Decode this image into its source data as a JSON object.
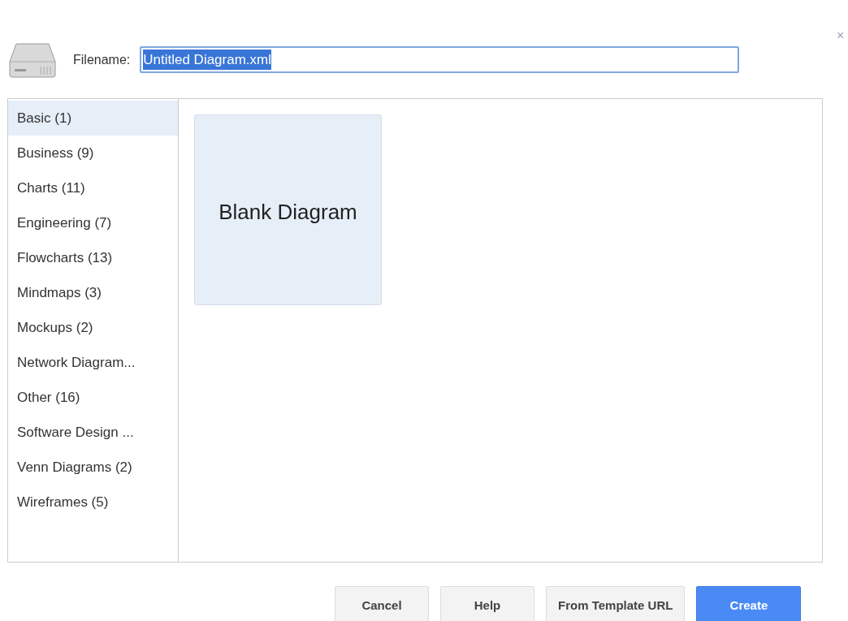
{
  "close": "×",
  "filename": {
    "label": "Filename:",
    "value": "Untitled Diagram.xml",
    "text_selected": true
  },
  "categories": [
    {
      "label": "Basic (1)",
      "selected": true
    },
    {
      "label": "Business (9)",
      "selected": false
    },
    {
      "label": "Charts (11)",
      "selected": false
    },
    {
      "label": "Engineering (7)",
      "selected": false
    },
    {
      "label": "Flowcharts (13)",
      "selected": false
    },
    {
      "label": "Mindmaps (3)",
      "selected": false
    },
    {
      "label": "Mockups (2)",
      "selected": false
    },
    {
      "label": "Network Diagram...",
      "selected": false
    },
    {
      "label": "Other (16)",
      "selected": false
    },
    {
      "label": "Software Design ...",
      "selected": false
    },
    {
      "label": "Venn Diagrams (2)",
      "selected": false
    },
    {
      "label": "Wireframes (5)",
      "selected": false
    }
  ],
  "templates": [
    {
      "label": "Blank Diagram"
    }
  ],
  "buttons": [
    {
      "label": "Cancel",
      "kind": "default"
    },
    {
      "label": "Help",
      "kind": "default"
    },
    {
      "label": "From Template URL",
      "kind": "default"
    },
    {
      "label": "Create",
      "kind": "primary"
    }
  ]
}
